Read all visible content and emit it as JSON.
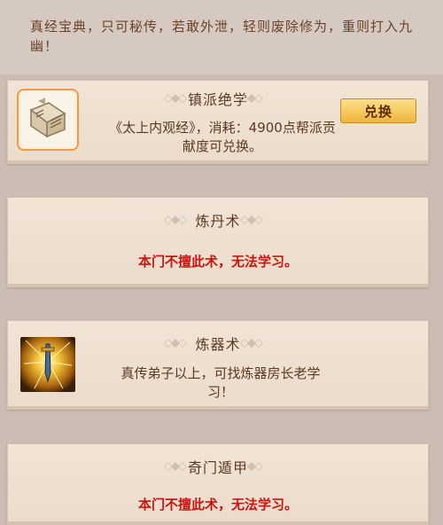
{
  "intro": "真经宝典，只可秘传，若敢外泄，轻则废除修为，重则打入九幽！",
  "cards": [
    {
      "title": "镇派绝学",
      "desc": "《太上内观经》，消耗：4900点帮派贡献度可兑换。",
      "button": "兑换",
      "icon": "scroll-book-icon"
    },
    {
      "title": "炼丹术",
      "desc": "本门不擅此术，无法学习。"
    },
    {
      "title": "炼器术",
      "desc": "真传弟子以上，可找炼器房长老学习！",
      "icon": "glowing-sword-icon"
    },
    {
      "title": "奇门遁甲",
      "desc": "本门不擅此术，无法学习。"
    }
  ],
  "colors": {
    "title_text": "#5b3a22",
    "warning_text": "#c8160f",
    "button_fill": "#f0b43c"
  }
}
